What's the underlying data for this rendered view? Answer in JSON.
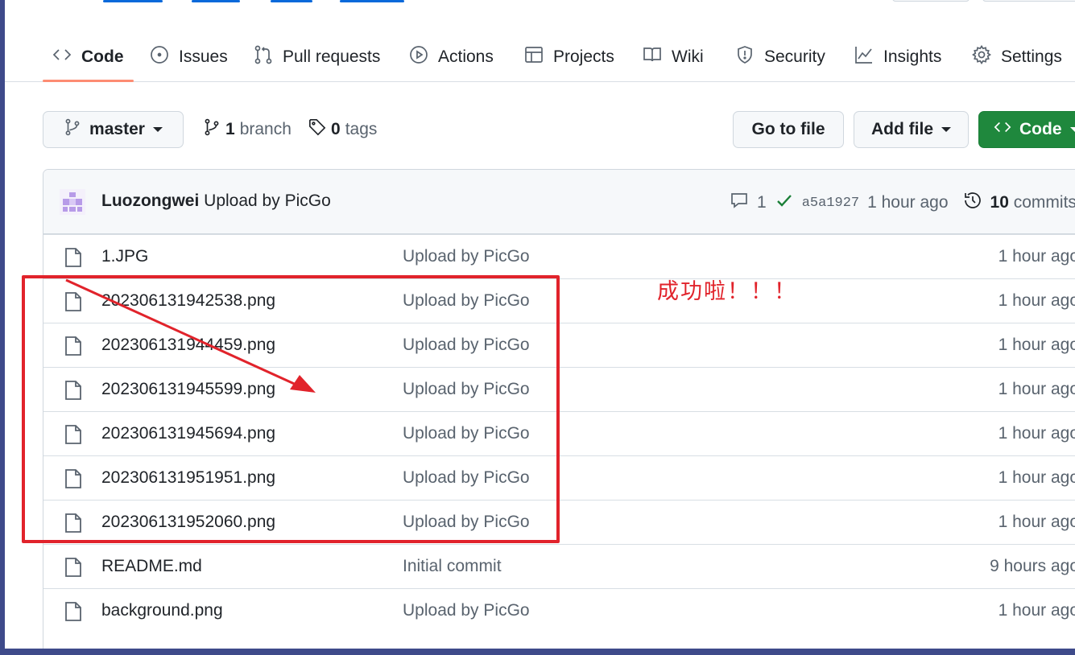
{
  "tabs": [
    {
      "label": "Code",
      "icon": "code-icon",
      "active": true
    },
    {
      "label": "Issues",
      "icon": "issue-icon"
    },
    {
      "label": "Pull requests",
      "icon": "pull-request-icon"
    },
    {
      "label": "Actions",
      "icon": "play-icon"
    },
    {
      "label": "Projects",
      "icon": "table-icon"
    },
    {
      "label": "Wiki",
      "icon": "book-icon"
    },
    {
      "label": "Security",
      "icon": "shield-icon"
    },
    {
      "label": "Insights",
      "icon": "graph-icon"
    },
    {
      "label": "Settings",
      "icon": "gear-icon"
    }
  ],
  "branch": {
    "current": "master",
    "branch_count": "1",
    "branch_label": "branch",
    "tag_count": "0",
    "tag_label": "tags"
  },
  "actions": {
    "go_to_file": "Go to file",
    "add_file": "Add file",
    "code": "Code"
  },
  "latest_commit": {
    "author": "Luozongwei",
    "message": "Upload by PicGo",
    "comment_count": "1",
    "sha": "a5a1927",
    "time": "1 hour ago",
    "commit_count": "10",
    "commit_label": "commits"
  },
  "files": [
    {
      "name": "1.JPG",
      "message": "Upload by PicGo",
      "age": "1 hour ago"
    },
    {
      "name": "202306131942538.png",
      "message": "Upload by PicGo",
      "age": "1 hour ago"
    },
    {
      "name": "202306131944459.png",
      "message": "Upload by PicGo",
      "age": "1 hour ago"
    },
    {
      "name": "202306131945599.png",
      "message": "Upload by PicGo",
      "age": "1 hour ago"
    },
    {
      "name": "202306131945694.png",
      "message": "Upload by PicGo",
      "age": "1 hour ago"
    },
    {
      "name": "202306131951951.png",
      "message": "Upload by PicGo",
      "age": "1 hour ago"
    },
    {
      "name": "202306131952060.png",
      "message": "Upload by PicGo",
      "age": "1 hour ago"
    },
    {
      "name": "README.md",
      "message": "Initial commit",
      "age": "9 hours ago"
    },
    {
      "name": "background.png",
      "message": "Upload by PicGo",
      "age": "1 hour ago"
    }
  ],
  "annotation": {
    "text": "成功啦！！！",
    "color": "#e1232b"
  },
  "colors": {
    "accent_blue": "#0969da",
    "green_button": "#1f883d",
    "tab_underline": "#fd8c73"
  }
}
